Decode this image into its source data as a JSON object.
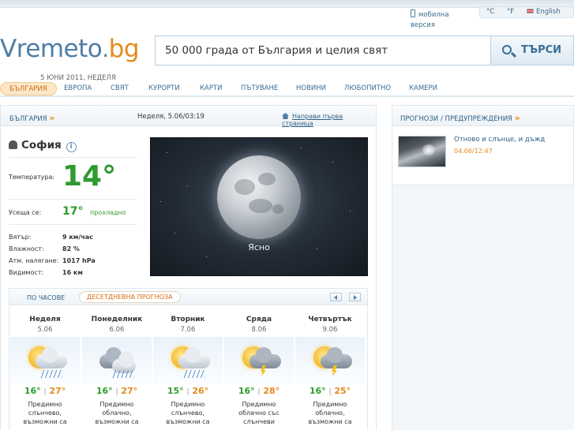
{
  "header": {
    "mobile_line1": "мобилна",
    "mobile_line2": "версия",
    "unit_c": "°C",
    "unit_f": "°F",
    "lang": "English",
    "logo_part1": "Vremeto",
    "logo_dot": ".",
    "logo_part2": "bg",
    "search_placeholder": "50 000 града от България и целия свят",
    "search_button": "ТЪРСИ",
    "date": "5 ЮНИ 2011, НЕДЕЛЯ"
  },
  "nav": {
    "items": [
      "БЪЛГАРИЯ",
      "ЕВРОПА",
      "СВЯТ",
      "КУРОРТИ",
      "КАРТИ",
      "ПЪТУВАНЕ",
      "НОВИНИ",
      "ЛЮБОПИТНО",
      "КАМЕРИ"
    ],
    "active_index": 0
  },
  "panel": {
    "crumb": "БЪЛГАРИЯ",
    "datetime": "Неделя, 5.06/03:19",
    "home_link": "Направи първа страница"
  },
  "current": {
    "city": "София",
    "temp_label": "Температура:",
    "temp": "14°",
    "feels_label": "Усеща се:",
    "feels": "17°",
    "feels_note": "прохладно",
    "wind_label": "Вятър:",
    "wind": "9 км/час",
    "humidity_label": "Влажност:",
    "humidity": "82 %",
    "pressure_label": "Атм. налягане:",
    "pressure": "1017 hPa",
    "visibility_label": "Видимост:",
    "visibility": "16 км",
    "sky_text": "Ясно"
  },
  "forecast": {
    "tab_hourly": "ПО ЧАСОВЕ",
    "tab_tenday": "ДЕСЕТДНЕВНА ПРОГНОЗА",
    "days": [
      {
        "name": "Неделя",
        "date": "5.06",
        "lo": "16°",
        "hi": "27°",
        "desc1": "Предимно",
        "desc2": "слънчево,",
        "desc3": "възможни са",
        "icon": "sun-cloud-rain-icon"
      },
      {
        "name": "Понеделник",
        "date": "6.06",
        "lo": "16°",
        "hi": "27°",
        "desc1": "Предимно",
        "desc2": "облачно,",
        "desc3": "възможни са",
        "icon": "cloud-rain-icon"
      },
      {
        "name": "Вторник",
        "date": "7.06",
        "lo": "15°",
        "hi": "26°",
        "desc1": "Предимно",
        "desc2": "слънчево,",
        "desc3": "възможни са",
        "icon": "sun-cloud-rain-icon"
      },
      {
        "name": "Сряда",
        "date": "8.06",
        "lo": "16°",
        "hi": "28°",
        "desc1": "Предимно",
        "desc2": "облачно със",
        "desc3": "слънчеви",
        "icon": "sun-cloud-storm-icon"
      },
      {
        "name": "Четвъртък",
        "date": "9.06",
        "lo": "16°",
        "hi": "25°",
        "desc1": "Предимно",
        "desc2": "облачно,",
        "desc3": "възможни са",
        "icon": "sun-cloud-storm-icon"
      }
    ]
  },
  "sidebar": {
    "title": "ПРОГНОЗИ / ПРЕДУПРЕЖДЕНИЯ",
    "news_title": "Отново и слънце, и дъжд",
    "news_date": "04.06/12:47"
  },
  "colors": {
    "brand_blue": "#4f7ea6",
    "brand_orange": "#e48a1f",
    "temp_green": "#2f9a2f"
  }
}
